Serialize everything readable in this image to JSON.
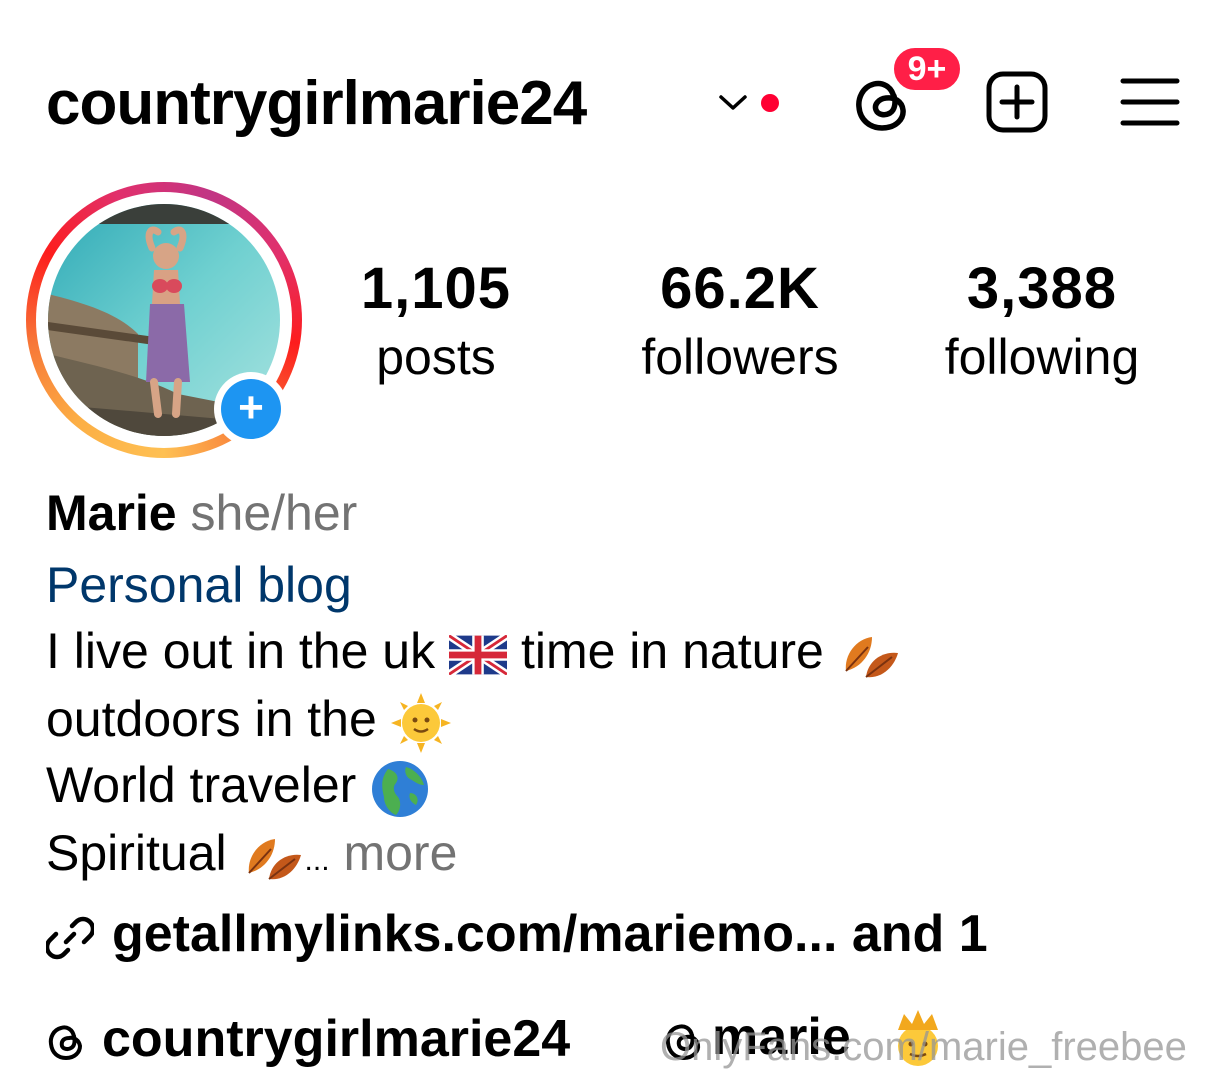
{
  "header": {
    "username": "countrygirlmarie24",
    "notification_badge": "9+",
    "icons": [
      "chevron-down-icon",
      "threads-icon",
      "create-post-icon",
      "menu-icon"
    ],
    "unread_dot_color": "#ff0033"
  },
  "stats": {
    "posts": {
      "value": "1,105",
      "label": "posts"
    },
    "followers": {
      "value": "66.2K",
      "label": "followers"
    },
    "following": {
      "value": "3,388",
      "label": "following"
    }
  },
  "bio": {
    "name": "Marie",
    "pronouns": "she/her",
    "category": "Personal blog",
    "line1": "I live out in the uk",
    "line1b": "time in nature",
    "line2": "outdoors in the",
    "line3": "World traveler",
    "line4": "Spiritual",
    "ellipsis": "...",
    "more": "more"
  },
  "links": {
    "text": "getallmylinks.com/mariemo...  and 1"
  },
  "footer": {
    "threads_handle": "countrygirlmarie24",
    "second_label": "marie",
    "watermark": "OnlyFans.com/marie_freebee"
  },
  "colors": {
    "accent_blue": "#1d95f2",
    "category_blue": "#00376b",
    "badge_red": "#ff1f47",
    "muted_grey": "#737373"
  }
}
